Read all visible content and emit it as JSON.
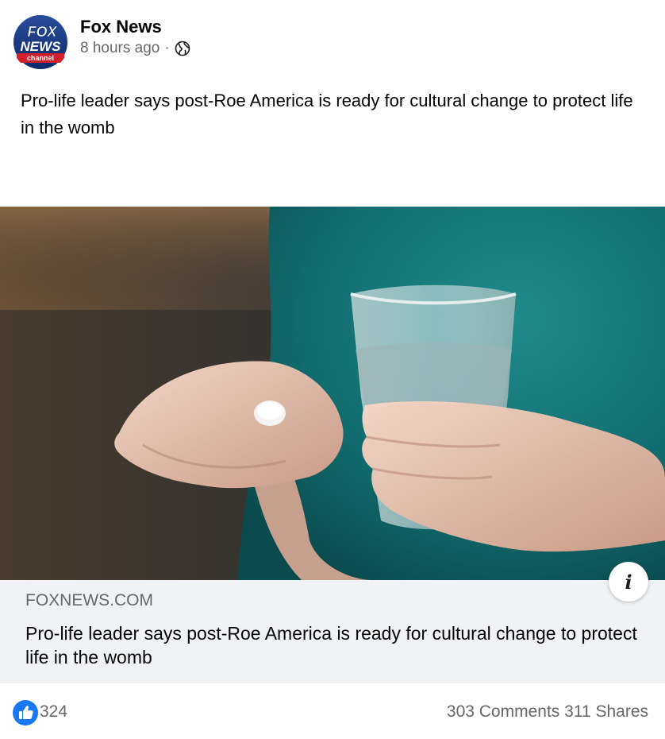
{
  "post": {
    "page_name": "Fox News",
    "logo": {
      "line1": "FOX",
      "line2": "NEWS",
      "line3": "channel"
    },
    "time": "8 hours ago",
    "separator": "·",
    "privacy_icon": "globe-icon",
    "text": "Pro-life leader says post-Roe America is ready for cultural change to protect life in the womb"
  },
  "link_preview": {
    "domain": "FOXNEWS.COM",
    "title": "Pro-life leader says post-Roe America is ready for cultural change to protect life in the womb",
    "info_icon_label": "i"
  },
  "engagement": {
    "reaction_icon": "like-icon",
    "likes": "324",
    "comments": "303 Comments",
    "shares": "311 Shares"
  },
  "colors": {
    "like_blue": "#1877f2",
    "secondary_text": "#65676b",
    "card_bg": "#f0f2f5"
  }
}
